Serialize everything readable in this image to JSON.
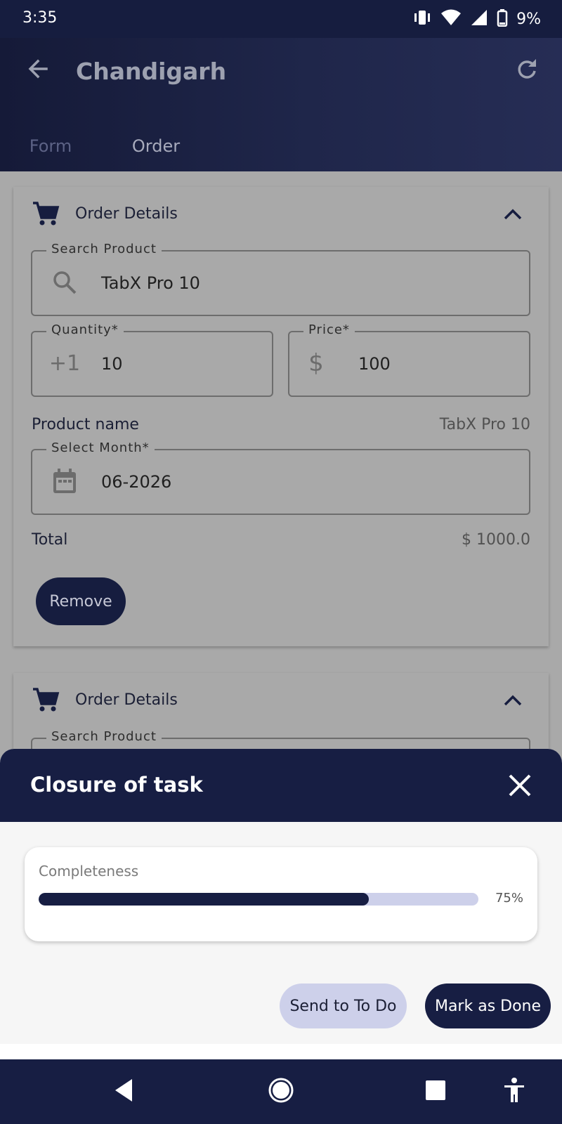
{
  "status_bar": {
    "time": "3:35",
    "battery_percent": "9%",
    "icons": [
      "vibrate-icon",
      "wifi-icon",
      "signal-icon",
      "battery-icon"
    ]
  },
  "header": {
    "title": "Chandigarh",
    "back_icon": "arrow-left-icon",
    "refresh_icon": "refresh-icon",
    "tabs": [
      {
        "label": "Form",
        "selected": false
      },
      {
        "label": "Order",
        "selected": true
      }
    ]
  },
  "orders": [
    {
      "title": "Order Details",
      "search_product": {
        "label": "Search Product",
        "value": "TabX Pro 10"
      },
      "quantity": {
        "label": "Quantity*",
        "icon_text": "+1",
        "value": "10"
      },
      "price": {
        "label": "Price*",
        "icon_text": "$",
        "value": "100"
      },
      "product_name": {
        "label": "Product name",
        "value": "TabX Pro 10"
      },
      "select_month": {
        "label": "Select Month*",
        "value": "06-2026"
      },
      "total": {
        "label": "Total",
        "value": "$ 1000.0"
      },
      "remove_label": "Remove"
    },
    {
      "title": "Order Details",
      "search_product": {
        "label": "Search Product",
        "value": ""
      }
    }
  ],
  "closure_sheet": {
    "title": "Closure of task",
    "completeness": {
      "label": "Completeness",
      "percent_text": "75%",
      "value": 0.75
    },
    "send_to_todo_label": "Send to To Do",
    "mark_done_label": "Mark as Done"
  },
  "colors": {
    "primary": "#171e43",
    "secondary": "#cdd0ea",
    "scrim": "#a9a9a9"
  }
}
